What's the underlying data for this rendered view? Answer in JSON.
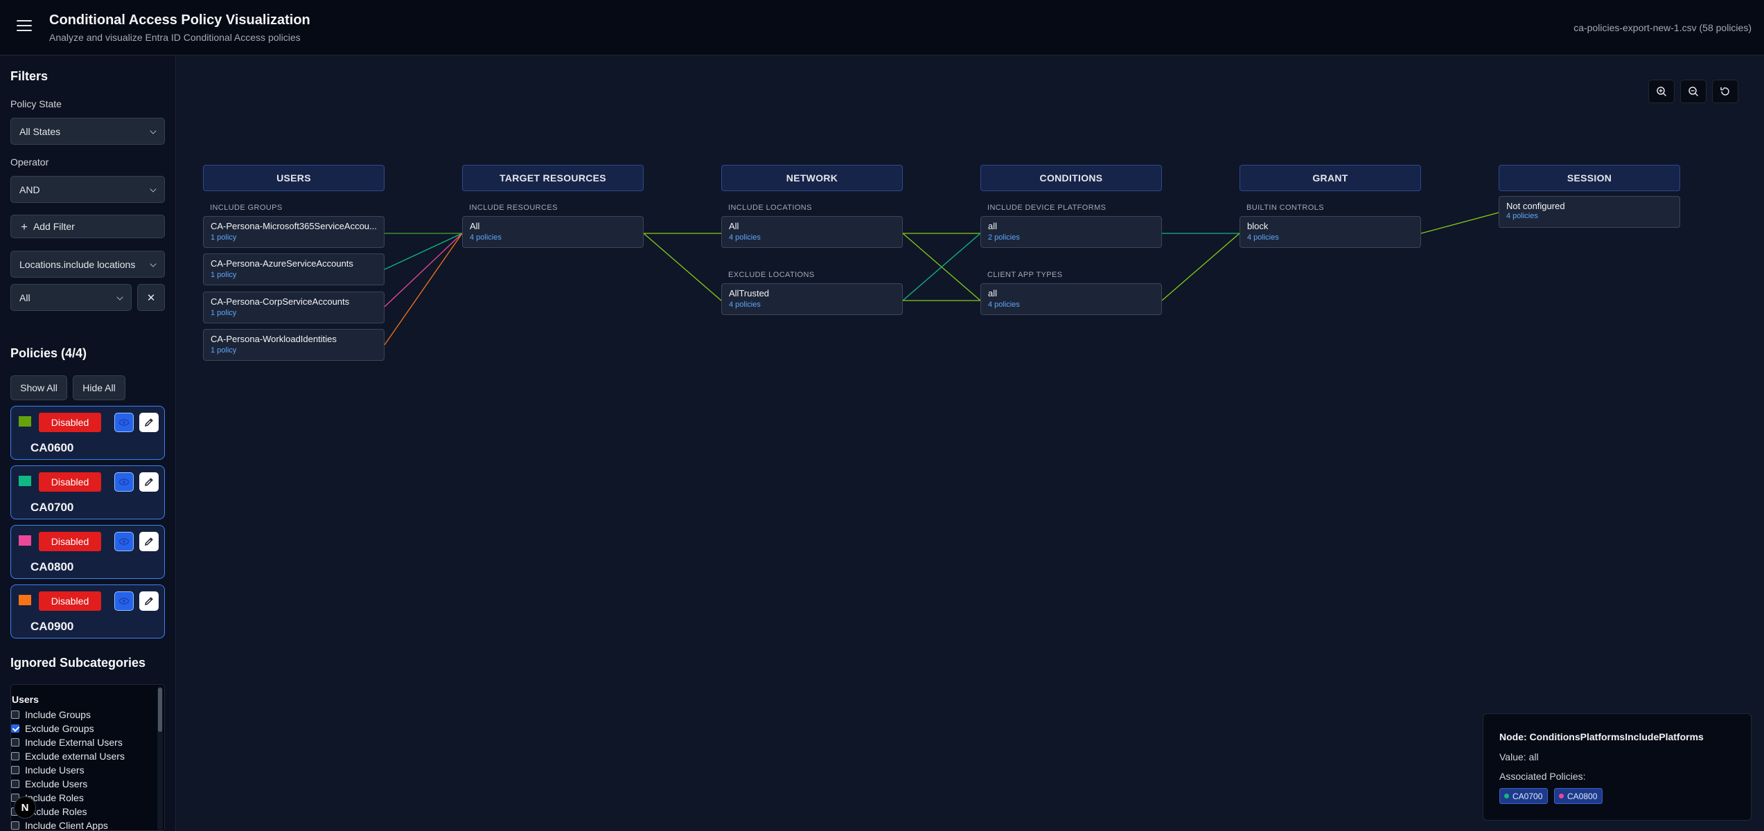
{
  "header": {
    "title": "Conditional Access Policy Visualization",
    "subtitle": "Analyze and visualize Entra ID Conditional Access policies",
    "file_name": "ca-policies-export-new-1.csv",
    "file_count": "(58 policies)"
  },
  "sidebar": {
    "filters_heading": "Filters",
    "policy_state_label": "Policy State",
    "policy_state_value": "All States",
    "operator_label": "Operator",
    "operator_value": "AND",
    "add_filter_label": "Add Filter",
    "filter_field_value": "Locations.include locations",
    "filter_value": "All",
    "policies_heading": "Policies (4/4)",
    "show_all_label": "Show All",
    "hide_all_label": "Hide All",
    "policies": [
      {
        "name": "CA0600",
        "state": "Disabled",
        "color": "#65a30d"
      },
      {
        "name": "CA0700",
        "state": "Disabled",
        "color": "#10b981"
      },
      {
        "name": "CA0800",
        "state": "Disabled",
        "color": "#ec4899"
      },
      {
        "name": "CA0900",
        "state": "Disabled",
        "color": "#f97316"
      }
    ],
    "ignored_heading": "Ignored Subcategories",
    "ignored_category": "Users",
    "ignored_items": [
      {
        "label": "Include Groups",
        "checked": false
      },
      {
        "label": "Exclude Groups",
        "checked": true
      },
      {
        "label": "Include External Users",
        "checked": false
      },
      {
        "label": "Exclude external Users",
        "checked": false
      },
      {
        "label": "Include Users",
        "checked": false
      },
      {
        "label": "Exclude Users",
        "checked": false
      },
      {
        "label": "Include Roles",
        "checked": false
      },
      {
        "label": "Exclude Roles",
        "checked": false
      },
      {
        "label": "Include Client Apps",
        "checked": false
      }
    ]
  },
  "canvas": {
    "columns": {
      "users": "USERS",
      "target": "TARGET RESOURCES",
      "network": "NETWORK",
      "conditions": "CONDITIONS",
      "grant": "GRANT",
      "session": "SESSION"
    },
    "sections": {
      "include_groups": "INCLUDE GROUPS",
      "include_resources": "INCLUDE RESOURCES",
      "include_locations": "INCLUDE LOCATIONS",
      "exclude_locations": "EXCLUDE LOCATIONS",
      "include_device_platforms": "INCLUDE DEVICE PLATFORMS",
      "client_app_types": "CLIENT APP TYPES",
      "builtin_controls": "BUILTIN CONTROLS"
    },
    "nodes": {
      "g1": {
        "title": "CA-Persona-Microsoft365ServiceAccou...",
        "count": "1 policy"
      },
      "g2": {
        "title": "CA-Persona-AzureServiceAccounts",
        "count": "1 policy"
      },
      "g3": {
        "title": "CA-Persona-CorpServiceAccounts",
        "count": "1 policy"
      },
      "g4": {
        "title": "CA-Persona-WorkloadIdentities",
        "count": "1 policy"
      },
      "res_all": {
        "title": "All",
        "count": "4 policies"
      },
      "loc_all": {
        "title": "All",
        "count": "4 policies"
      },
      "loc_trusted": {
        "title": "AllTrusted",
        "count": "4 policies"
      },
      "plat_all": {
        "title": "all",
        "count": "2 policies"
      },
      "app_all": {
        "title": "all",
        "count": "4 policies"
      },
      "grant_block": {
        "title": "block",
        "count": "4 policies"
      },
      "session_none": {
        "title": "Not configured",
        "count": "4 policies"
      }
    }
  },
  "tooltip": {
    "node": "Node: ConditionsPlatformsIncludePlatforms",
    "value": "Value: all",
    "associated_label": "Associated Policies:",
    "chips": [
      {
        "name": "CA0700",
        "color": "#10b981"
      },
      {
        "name": "CA0800",
        "color": "#ec4899"
      }
    ]
  },
  "badge": {
    "letter": "N"
  }
}
